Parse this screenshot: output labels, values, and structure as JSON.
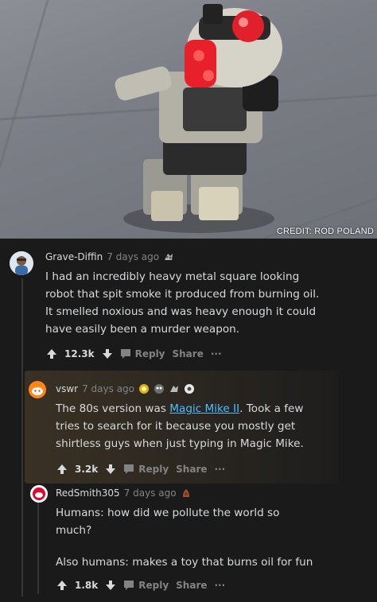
{
  "photo": {
    "credit": "CREDIT: ROD POLAND",
    "subject": "toy-robot"
  },
  "colors": {
    "background": "#1a1a1b",
    "text": "#d7dadc",
    "muted": "#818384",
    "link": "#4fbcff",
    "highlight": "#3a3124"
  },
  "comments": [
    {
      "username": "Grave-Diffin",
      "time": "7 days ago",
      "body": "I had an incredibly heavy metal square looking robot that spit smoke it produced from burning oil. It smelled noxious and was heavy enough it could have easily been a murder weapon.",
      "score": "12.3k",
      "reply_label": "Reply",
      "share_label": "Share",
      "more_label": "···",
      "awards": [
        "award-icon"
      ]
    },
    {
      "username": "vswr",
      "time": "7 days ago",
      "body_before": "The 80s version was ",
      "body_link": "Magic Mike II",
      "body_after": ". Took a few tries to search for it because you mostly get shirtless guys when just typing in Magic Mike.",
      "score": "3.2k",
      "reply_label": "Reply",
      "share_label": "Share",
      "more_label": "···",
      "awards": [
        "gold-award-icon",
        "award-icon",
        "award-icon",
        "award-icon"
      ]
    },
    {
      "username": "RedSmith305",
      "time": "7 days ago",
      "body_line1": "Humans: how did we pollute the world so much?",
      "body_line2": "Also humans: makes a toy that burns oil for fun",
      "score": "1.8k",
      "reply_label": "Reply",
      "share_label": "Share",
      "more_label": "···",
      "awards": [
        "award-icon"
      ]
    }
  ]
}
